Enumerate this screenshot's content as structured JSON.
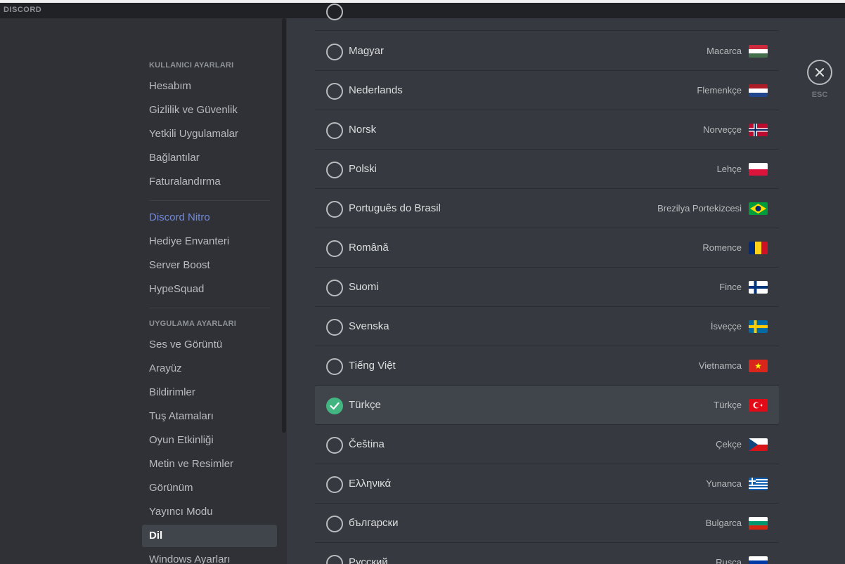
{
  "app": {
    "logo": "DISCORD"
  },
  "sidebar": {
    "user_header": "KULLANICI AYARLARI",
    "user_items": [
      "Hesabım",
      "Gizlilik ve Güvenlik",
      "Yetkili Uygulamalar",
      "Bağlantılar",
      "Faturalandırma"
    ],
    "nitro_item": "Discord Nitro",
    "billing_items": [
      "Hediye Envanteri",
      "Server Boost",
      "HypeSquad"
    ],
    "app_header": "UYGULAMA AYARLARI",
    "app_items": [
      "Ses ve Görüntü",
      "Arayüz",
      "Bildirimler",
      "Tuş Atamaları",
      "Oyun Etkinliği",
      "Metin ve Resimler",
      "Görünüm",
      "Yayıncı Modu"
    ],
    "active_item": "Dil",
    "last_item": "Windows Ayarları"
  },
  "languages": [
    {
      "name": "Magyar",
      "local": "Macarca",
      "flag": "hu",
      "selected": false
    },
    {
      "name": "Nederlands",
      "local": "Flemenkçe",
      "flag": "nl",
      "selected": false
    },
    {
      "name": "Norsk",
      "local": "Norveççe",
      "flag": "no",
      "selected": false
    },
    {
      "name": "Polski",
      "local": "Lehçe",
      "flag": "pl",
      "selected": false
    },
    {
      "name": "Português do Brasil",
      "local": "Brezilya Portekizcesi",
      "flag": "br",
      "selected": false
    },
    {
      "name": "Română",
      "local": "Romence",
      "flag": "ro",
      "selected": false
    },
    {
      "name": "Suomi",
      "local": "Fince",
      "flag": "fi",
      "selected": false
    },
    {
      "name": "Svenska",
      "local": "İsveççe",
      "flag": "se",
      "selected": false
    },
    {
      "name": "Tiếng Việt",
      "local": "Vietnamca",
      "flag": "vn",
      "selected": false
    },
    {
      "name": "Türkçe",
      "local": "Türkçe",
      "flag": "tr",
      "selected": true
    },
    {
      "name": "Čeština",
      "local": "Çekçe",
      "flag": "cz",
      "selected": false
    },
    {
      "name": "Ελληνικά",
      "local": "Yunanca",
      "flag": "gr",
      "selected": false
    },
    {
      "name": "български",
      "local": "Bulgarca",
      "flag": "bg",
      "selected": false
    },
    {
      "name": "Русский",
      "local": "Rusca",
      "flag": "ru",
      "selected": false
    }
  ],
  "close": {
    "label": "ESC",
    "icon": "close-icon"
  },
  "colors": {
    "accent": "#7289da",
    "selected_check": "#43b581",
    "background": "#36393f",
    "sidebar": "#2f3136"
  }
}
